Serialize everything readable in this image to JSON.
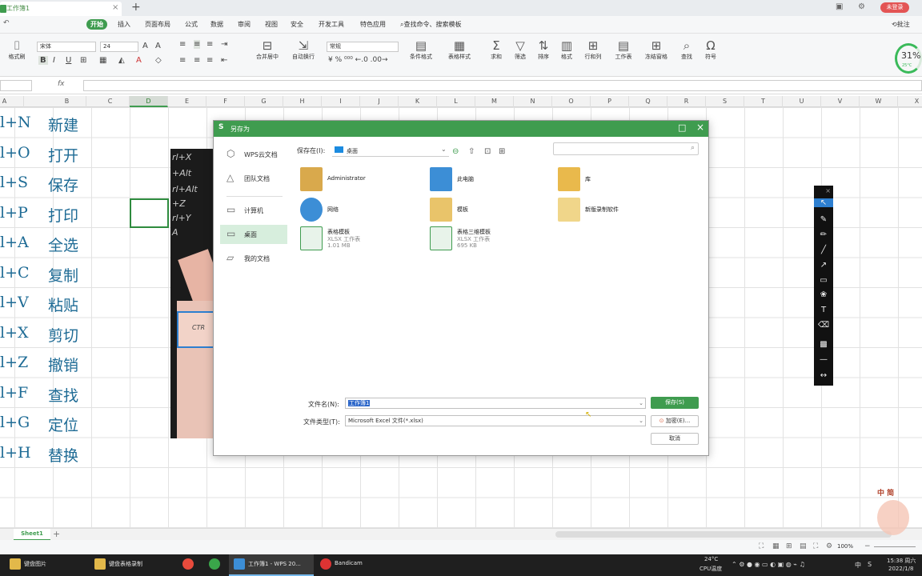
{
  "window": {
    "doc_tab": "工作簿1",
    "login_badge": "未登录"
  },
  "menu": {
    "items": [
      "开始",
      "插入",
      "页面布局",
      "公式",
      "数据",
      "审阅",
      "视图",
      "安全",
      "开发工具",
      "特色应用"
    ],
    "search": "查找命令、搜索模板",
    "annotate": "批注"
  },
  "ribbon": {
    "paste_label": "格式刷",
    "font_name": "宋体",
    "font_size": "24",
    "merge_center": "合并居中",
    "wrap_text": "自动换行",
    "number_format": "常规",
    "conditional_format": "条件格式",
    "table_style": "表格样式",
    "sum": "求和",
    "filter": "筛选",
    "sort": "排序",
    "format": "格式",
    "row_col": "行和列",
    "worksheet": "工作表",
    "freeze": "冻结窗格",
    "find": "查找",
    "symbol": "符号",
    "perf_percent": "31%",
    "perf_temp": "25°C"
  },
  "formula_bar": {
    "fx": "fx"
  },
  "columns": [
    "A",
    "B",
    "C",
    "D",
    "E",
    "F",
    "G",
    "H",
    "I",
    "J",
    "K",
    "L",
    "M",
    "N",
    "O",
    "P",
    "Q",
    "R",
    "S",
    "T",
    "U",
    "V",
    "W",
    "X"
  ],
  "rows": [
    {
      "shortcut": "l+N",
      "action": "新建"
    },
    {
      "shortcut": "l+O",
      "action": "打开"
    },
    {
      "shortcut": "l+S",
      "action": "保存"
    },
    {
      "shortcut": "l+P",
      "action": "打印"
    },
    {
      "shortcut": "l+A",
      "action": "全选"
    },
    {
      "shortcut": "l+C",
      "action": "复制"
    },
    {
      "shortcut": "l+V",
      "action": "粘贴"
    },
    {
      "shortcut": "l+X",
      "action": "剪切"
    },
    {
      "shortcut": "l+Z",
      "action": "撤销"
    },
    {
      "shortcut": "l+F",
      "action": "查找"
    },
    {
      "shortcut": "l+G",
      "action": "定位"
    },
    {
      "shortcut": "l+H",
      "action": "替换"
    }
  ],
  "picture": {
    "key_text": [
      "rl+X",
      "+Alt",
      "rl+Alt",
      "+Z",
      "rl+Y",
      "A"
    ],
    "ctrl_key": "CTR"
  },
  "dialog": {
    "title": "另存为",
    "sidebar": [
      {
        "label": "WPS云文档",
        "icon": "cloud-icon"
      },
      {
        "label": "团队文档",
        "icon": "team-icon"
      },
      {
        "label": "计算机",
        "icon": "computer-icon"
      },
      {
        "label": "桌面",
        "icon": "desktop-icon"
      },
      {
        "label": "我的文档",
        "icon": "documents-icon"
      }
    ],
    "save_in_label": "保存在(I):",
    "save_in_value": "桌面",
    "files": [
      {
        "name": "Administrator",
        "type": "",
        "size": ""
      },
      {
        "name": "此电脑",
        "type": "",
        "size": ""
      },
      {
        "name": "库",
        "type": "",
        "size": ""
      },
      {
        "name": "网络",
        "type": "",
        "size": ""
      },
      {
        "name": "模板",
        "type": "",
        "size": ""
      },
      {
        "name": "新版录制软件",
        "type": "",
        "size": ""
      },
      {
        "name": "表格模板",
        "type": "XLSX 工作表",
        "size": "1.01 MB"
      },
      {
        "name": "表格三维模板",
        "type": "XLSX 工作表",
        "size": "695 KB"
      }
    ],
    "filename_label": "文件名(N):",
    "filename_value": "工作簿1",
    "filetype_label": "文件类型(T):",
    "filetype_value": "Microsoft Excel 文件(*.xlsx)",
    "save_button": "保存(S)",
    "encrypt_button": "加密(E)...",
    "cancel_button": "取消"
  },
  "sheets": {
    "active": "Sheet1"
  },
  "status": {
    "zoom": "100%"
  },
  "taskbar": {
    "items": [
      "键盘图片",
      "键盘表格录制",
      "工作簿1 - WPS 20...",
      "Bandicam"
    ],
    "weather_temp": "24°C",
    "weather_label": "CPU温度",
    "ime": "中",
    "time": "15:38 周六",
    "date": "2022/1/8"
  },
  "watermark": {
    "text": "中 简"
  },
  "colors": {
    "accent": "#3f9c4f",
    "highlight_box": "#2d7fd0",
    "cell_text": "#1e6b95",
    "taskbar": "#1f1f1f"
  }
}
